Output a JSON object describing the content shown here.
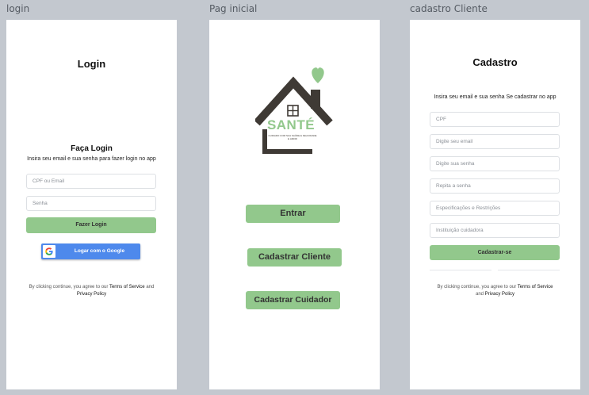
{
  "frames": {
    "login": {
      "label": "login",
      "title": "Login",
      "subtitle": "Faça Login",
      "hint": "Insira seu email e sua senha para fazer login no app",
      "cpf_placeholder": "CPF ou Email",
      "password_placeholder": "Senha",
      "login_button": "Fazer Login",
      "google_button": "Logar com o Google",
      "terms_prefix": "By clicking continue, you agree to our",
      "terms_link": "Terms of Service",
      "terms_and": "and",
      "privacy_link": "Privacy Policy"
    },
    "home": {
      "label": "Pag inicial",
      "logo_text": "SANTÉ",
      "logo_tagline": "CUIDADO COM SUA SAÚDE E FELICIDADE E AMOR",
      "enter_button": "Entrar",
      "register_client_button": "Cadastrar Cliente",
      "register_caregiver_button": "Cadastrar Cuidador"
    },
    "signup": {
      "label": "cadastro Cliente",
      "title": "Cadastro",
      "hint": "Insira seu email e sua senha Se cadastrar no app",
      "fields": [
        "CPF",
        "Digite seu email",
        "Digite sua senha",
        "Repita a senha",
        "Especificações e Restrições",
        "Instituição cuidadora"
      ],
      "submit_button": "Cadastrar-se",
      "terms_prefix": "By clicking continue, you agree to our",
      "terms_link": "Terms of Service",
      "terms_and": "and",
      "privacy_link": "Privacy Policy"
    }
  },
  "colors": {
    "accent_green": "#92c88c",
    "logo_brown": "#3f3a35",
    "google_blue": "#4e89ec",
    "canvas": "#c3c8cf"
  },
  "icons": {
    "google": "google-g-icon",
    "logo": "house-heart-logo-icon"
  }
}
